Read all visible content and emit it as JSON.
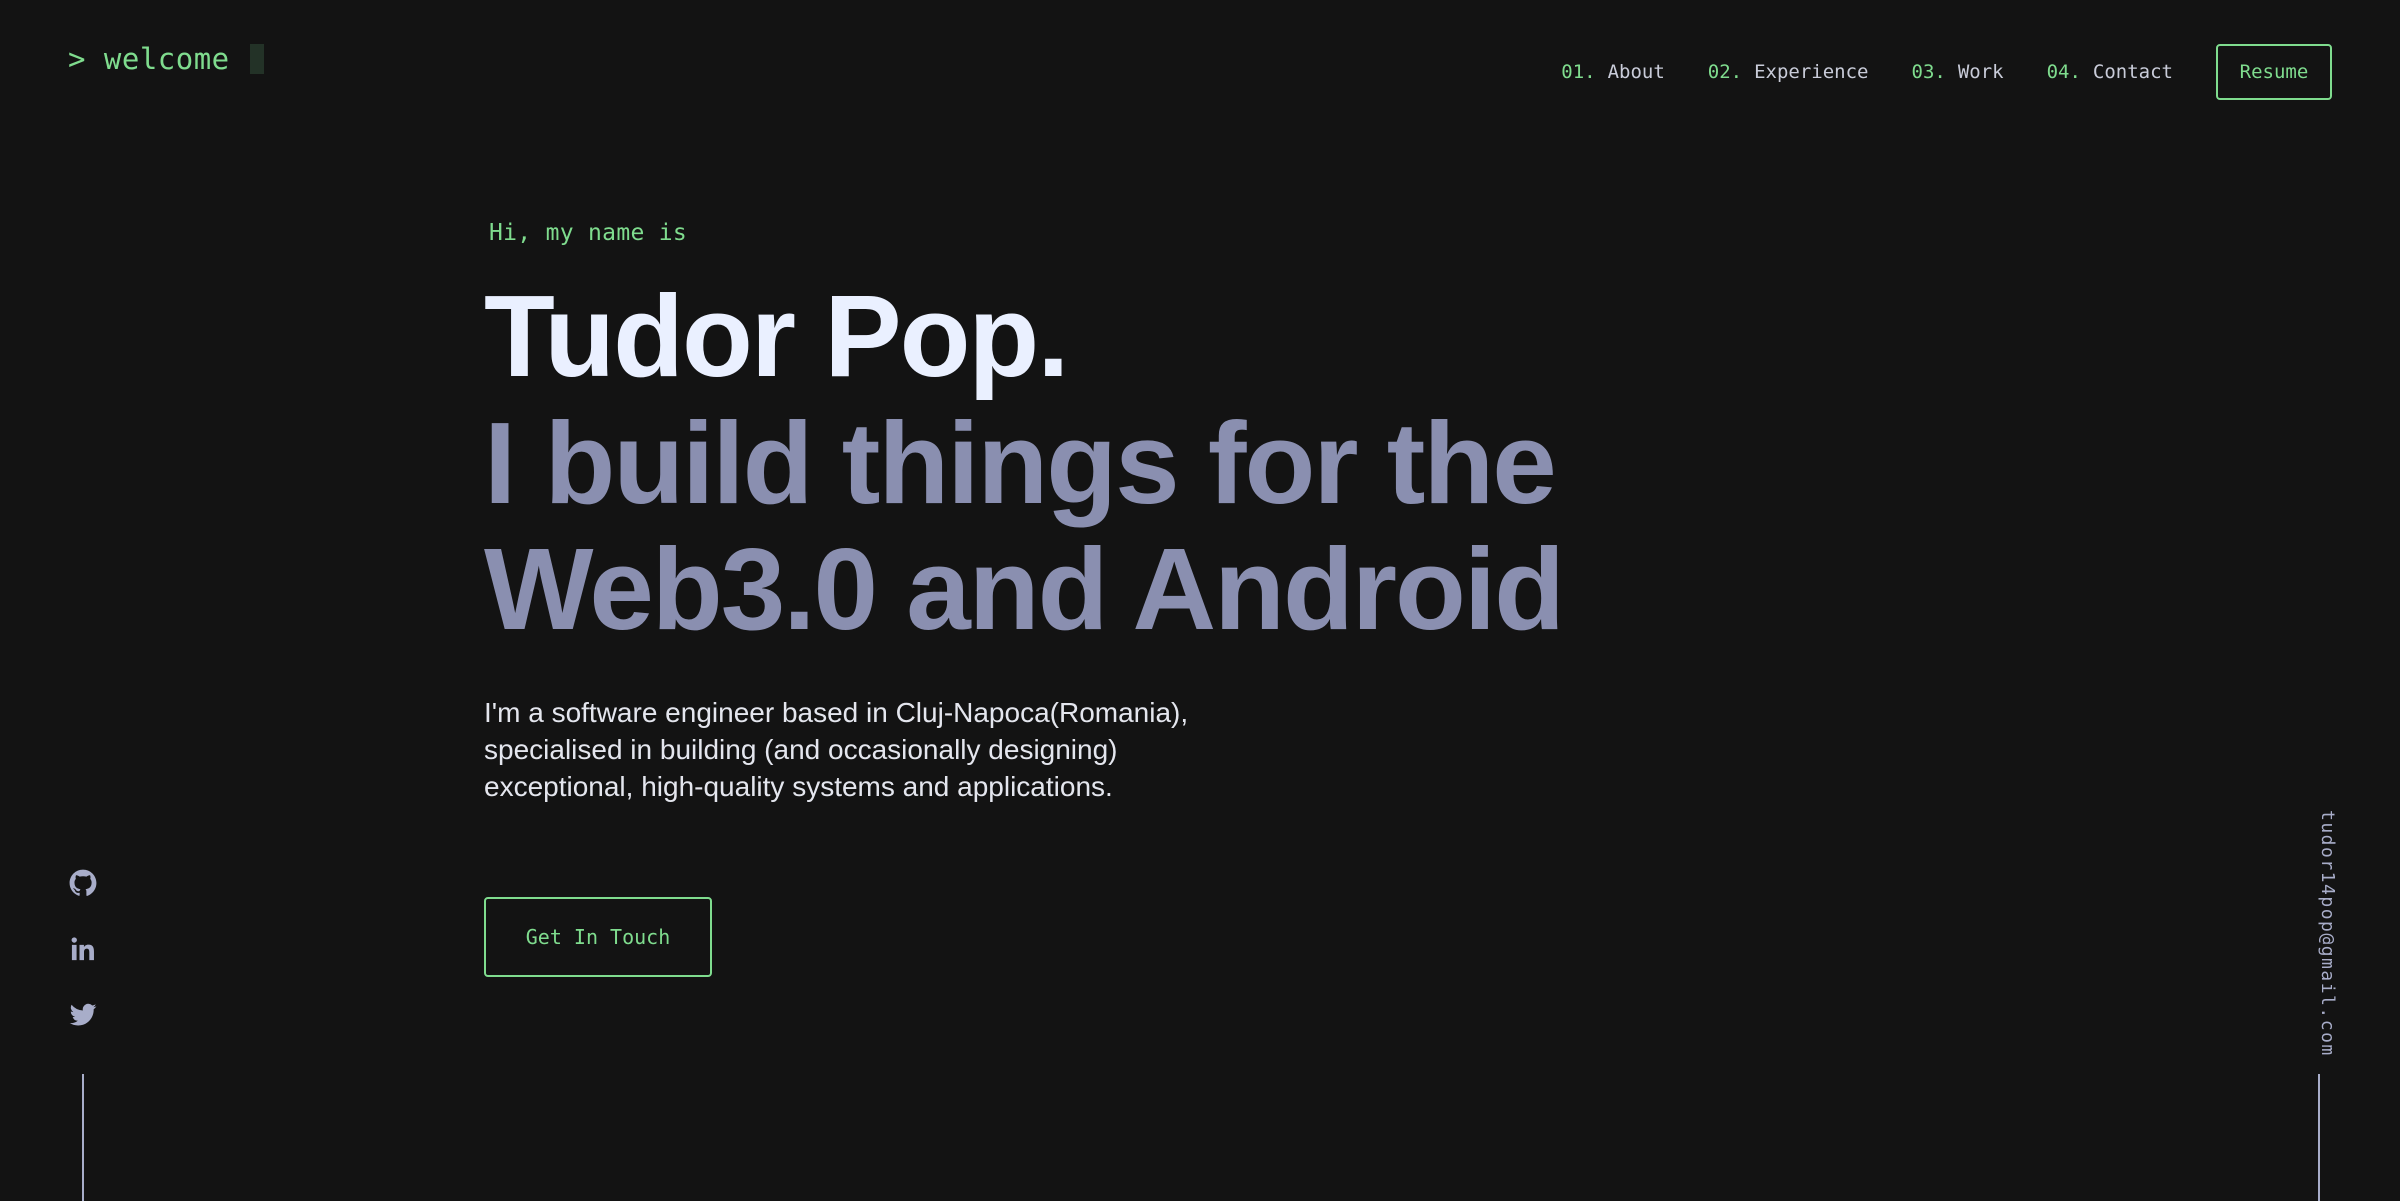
{
  "header": {
    "logo_text": "> welcome",
    "nav": [
      {
        "num": "01.",
        "label": "About"
      },
      {
        "num": "02.",
        "label": "Experience"
      },
      {
        "num": "03.",
        "label": "Work"
      },
      {
        "num": "04.",
        "label": "Contact"
      }
    ],
    "resume_label": "Resume"
  },
  "hero": {
    "greeting": "Hi, my name is",
    "name": "Tudor Pop.",
    "tagline": "I build things for the Web3.0 and Android",
    "bio_lines": [
      "I'm a software engineer based in Cluj-Napoca(Romania),",
      "specialised in building (and occasionally designing)",
      "exceptional, high-quality systems and applications."
    ],
    "cta_label": "Get In Touch"
  },
  "socials": [
    "github-icon",
    "linkedin-icon",
    "twitter-icon"
  ],
  "email": "tudor14pop@gmail.com",
  "colors": {
    "background": "#131313",
    "accent": "#7fdc8e",
    "heading": "#eaf0ff",
    "muted": "#8a8fb0",
    "text": "#e4e6ee"
  }
}
